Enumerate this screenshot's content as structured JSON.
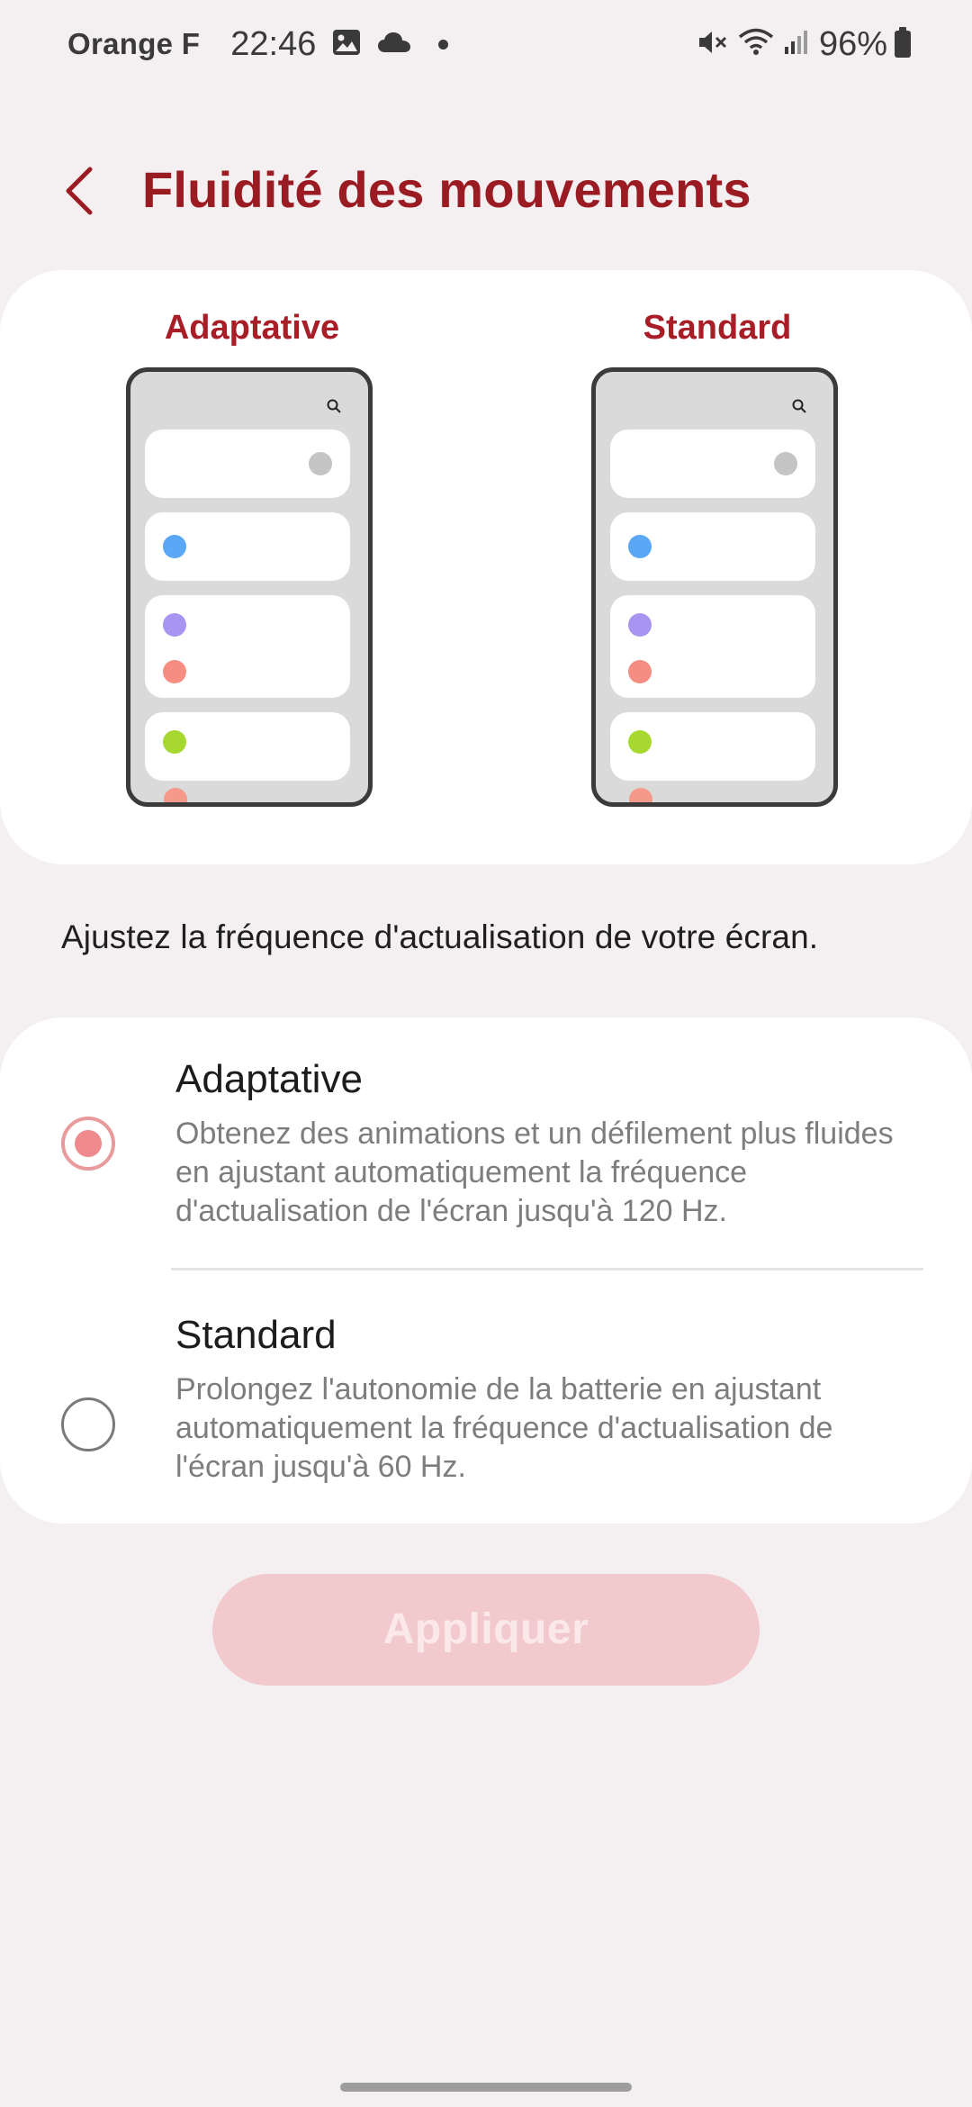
{
  "status_bar": {
    "carrier": "Orange F",
    "time": "22:46",
    "battery": "96%",
    "icons": [
      "gallery-icon",
      "cloud-icon",
      "mute-icon",
      "wifi-icon",
      "signal-icon",
      "battery-icon"
    ]
  },
  "header": {
    "title": "Fluidité des mouvements",
    "back_icon": "chevron-left-icon"
  },
  "preview": {
    "left_label": "Adaptative",
    "right_label": "Standard"
  },
  "description": "Ajustez la fréquence d'actualisation de votre écran.",
  "options": [
    {
      "title": "Adaptative",
      "description": "Obtenez des animations et un défilement plus fluides en ajustant automatiquement la fréquence d'actualisation de l'écran jusqu'à 120 Hz.",
      "selected": true
    },
    {
      "title": "Standard",
      "description": "Prolongez l'autonomie de la batterie en ajustant automatiquement la fréquence d'actualisation de l'écran jusqu'à 60 Hz.",
      "selected": false
    }
  ],
  "apply_button": {
    "label": "Appliquer",
    "enabled": false
  },
  "colors": {
    "accent": "#9b1b23",
    "background": "#f4f0f1",
    "radio_selected": "#ef8a8f",
    "button_disabled": "#f2c9cc"
  }
}
